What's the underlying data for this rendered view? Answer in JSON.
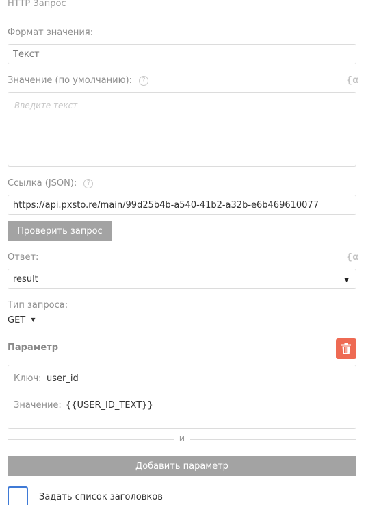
{
  "section": {
    "title": "HTTP Запрос"
  },
  "format": {
    "label": "Формат значения:",
    "value": "Текст"
  },
  "default_value": {
    "label": "Значение (по умолчанию):",
    "help": "?",
    "var_icon": "{α",
    "placeholder": "Введите текст"
  },
  "url": {
    "label": "Ссылка (JSON):",
    "help": "?",
    "value": "https://api.pxsto.re/main/99d25b4b-a540-41b2-a32b-e6b469610077"
  },
  "check_button": {
    "label": "Проверить запрос"
  },
  "response": {
    "label": "Ответ:",
    "var_icon": "{α",
    "value": "result",
    "arrow": "▼"
  },
  "request_type": {
    "label": "Тип запроса:",
    "value": "GET",
    "arrow": "▼"
  },
  "parameter": {
    "title": "Параметр",
    "delete_icon": "trash-icon",
    "key_label": "Ключ:",
    "key_value": "user_id",
    "value_label": "Значение:",
    "value_value": "{{USER_ID_TEXT}}"
  },
  "separator": {
    "text": "и"
  },
  "add_param_button": {
    "label": "Добавить параметр"
  },
  "headers_checkbox": {
    "label": "Задать список заголовков",
    "checked": false
  },
  "colors": {
    "delete": "#ee6a53",
    "button_gray": "#a3a3a3",
    "checkbox_border": "#3f7ad6"
  }
}
